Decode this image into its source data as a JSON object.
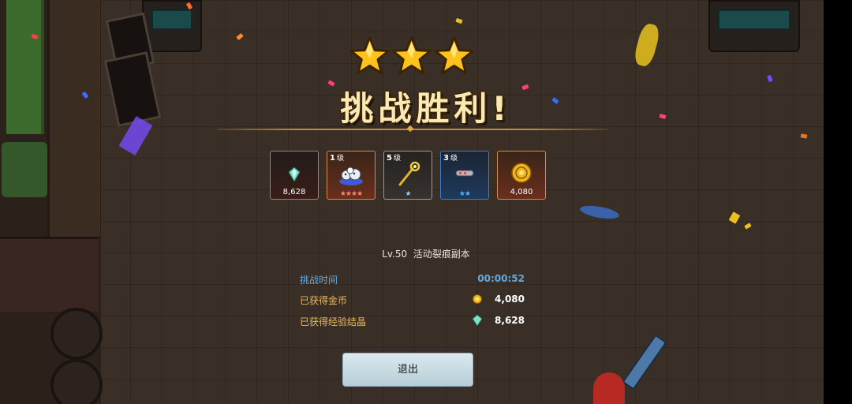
{
  "result": {
    "star_count": 3,
    "title": "挑战胜利!",
    "stage": "Lv.50  活动裂痕副本"
  },
  "rewards": [
    {
      "name": "crystal-reward",
      "level": "",
      "level_unit": "",
      "quantity": "8,628",
      "stars": 0,
      "star_color": "",
      "frame": "dark"
    },
    {
      "name": "creature-reward",
      "level": "1",
      "level_unit": "级",
      "quantity": "",
      "stars": 4,
      "star_color": "#ff8a6a",
      "frame": "orange"
    },
    {
      "name": "staff-reward",
      "level": "5",
      "level_unit": "级",
      "quantity": "",
      "stars": 1,
      "star_color": "#8fd0ff",
      "frame": "grey"
    },
    {
      "name": "blaster-reward",
      "level": "3",
      "level_unit": "级",
      "quantity": "",
      "stars": 2,
      "star_color": "#4fb4ff",
      "frame": "blue"
    },
    {
      "name": "gold-coin-reward",
      "level": "",
      "level_unit": "",
      "quantity": "4,080",
      "stars": 0,
      "star_color": "",
      "frame": "orange"
    }
  ],
  "stats": {
    "time_label": "挑战时间",
    "time_value": "00:00:52",
    "gold_label": "已获得金币",
    "gold_value": "4,080",
    "exp_label": "已获得经验结晶",
    "exp_value": "8,628"
  },
  "exit_button": "退出",
  "colors": {
    "gold": "#e9b85c",
    "time_blue": "#63a9e0",
    "title_text": "#fbe9b4"
  }
}
